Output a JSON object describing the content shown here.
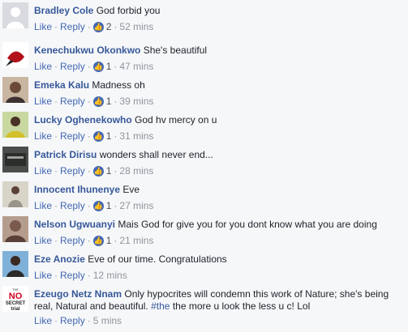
{
  "actions": {
    "like": "Like",
    "reply": "Reply"
  },
  "comments": [
    {
      "author": "Bradley Cole",
      "text": "God forbid you",
      "likes": "2",
      "time": "52 mins",
      "avatar_color": "#d9dbe0"
    },
    {
      "author": "Kenechukwu Okonkwo",
      "text": "She's beautiful",
      "likes": "1",
      "time": "47 mins",
      "avatar_color": "#b3121b"
    },
    {
      "author": "Emeka Kalu",
      "text": "Madness oh",
      "likes": "1",
      "time": "39 mins",
      "avatar_color": "#6b4a3a"
    },
    {
      "author": "Lucky Oghenekowho",
      "text": "God hv mercy on u",
      "likes": "1",
      "time": "31 mins",
      "avatar_color": "#8aa13c"
    },
    {
      "author": "Patrick Dirisu",
      "text": "wonders shall never end...",
      "likes": "1",
      "time": "28 mins",
      "avatar_color": "#4b4d4a"
    },
    {
      "author": "Innocent Ihunenye",
      "text": "Eve",
      "likes": "1",
      "time": "27 mins",
      "avatar_color": "#9a958a"
    },
    {
      "author": "Nelson Ugwuanyi",
      "text": "Mais God for give you for you dont know what you are doing",
      "likes": "1",
      "time": "21 mins",
      "avatar_color": "#7a5a4c"
    },
    {
      "author": "Eze Anozie",
      "text": "Eve of our time. Congratulations",
      "likes": "",
      "time": "12 mins",
      "avatar_color": "#7fb1d9"
    },
    {
      "author": "Ezeugo Netz Nnam",
      "text": "Only hypocrites will condemn this work of Nature; she's being real, Natural and beautiful.",
      "hashtag": "#the",
      "text2": "the more u look the less u c! Lol",
      "likes": "",
      "time": "5 mins",
      "avatar_color": "#ffffff",
      "avatar_text": {
        "top": "THE",
        "main": "NO",
        "mid": "SECRET",
        "bottom": "trial"
      }
    }
  ]
}
